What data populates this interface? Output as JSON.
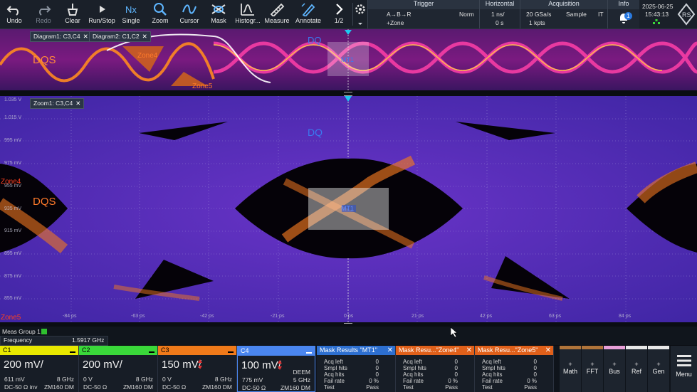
{
  "toolbar": {
    "buttons": [
      {
        "label": "Undo",
        "icon": "undo-icon"
      },
      {
        "label": "Redo",
        "icon": "redo-icon"
      },
      {
        "label": "Clear",
        "icon": "clear-icon"
      },
      {
        "label": "Run/Stop",
        "icon": "run-stop-icon"
      },
      {
        "label": "Single",
        "icon": "single-icon"
      },
      {
        "label": "Zoom",
        "icon": "zoom-icon"
      },
      {
        "label": "Cursor",
        "icon": "cursor-icon"
      },
      {
        "label": "Mask",
        "icon": "mask-icon"
      },
      {
        "label": "Histogr...",
        "icon": "histogram-icon"
      },
      {
        "label": "Measure",
        "icon": "measure-icon"
      },
      {
        "label": "Annotate",
        "icon": "annotate-icon"
      },
      {
        "label": "1/2",
        "icon": "next-page-icon"
      }
    ],
    "trigger": {
      "header": "Trigger",
      "line1": "A→B→R",
      "line2": "+Zone",
      "mode": "Norm"
    },
    "horizontal": {
      "header": "Horizontal",
      "timebase": "1 ns/",
      "position": "0 s"
    },
    "acquisition": {
      "header": "Acquisition",
      "rate": "20 GSa/s",
      "mode": "Sample",
      "points": "1 kpts",
      "it": "IT"
    },
    "info": {
      "header": "Info",
      "badge": "1"
    },
    "date": "2025-06-25",
    "time": "15:43:13"
  },
  "diagram1": {
    "tab1": "Diagram1: C3,C4",
    "tab2": "Diagram2: C1,C2",
    "labels": {
      "dqs": "DQS",
      "dq": "DQ",
      "zone4": "Zone4",
      "zone5": "Zone5",
      "mt1": "MT1"
    }
  },
  "zoom1": {
    "tab": "Zoom1: C3,C4",
    "labels": {
      "dqs": "DQS",
      "dq": "DQ",
      "zone4": "Zone4",
      "zone5": "Zone5",
      "mt1": "MT1"
    },
    "xticks": [
      "-84 ps",
      "-63 ps",
      "-42 ps",
      "-21 ps",
      "0 ps",
      "21 ps",
      "42 ps",
      "63 ps",
      "84 ps"
    ],
    "yticks": [
      "1.035 V",
      "1.015 V",
      "995 mV",
      "975 mV",
      "955 mV",
      "935 mV",
      "915 mV",
      "895 mV",
      "875 mV",
      "855 mV"
    ]
  },
  "meas": {
    "group": "Meas Group 1",
    "name": "Frequency",
    "value": "1.5917 GHz"
  },
  "channels": [
    {
      "name": "C1",
      "color": "#e8e800",
      "scale": "200 mV/",
      "offset": "611 mV",
      "bw": "8 GHz",
      "coupling": "DC-50 Ω inv",
      "probe": "ZM160 DM"
    },
    {
      "name": "C2",
      "color": "#3ad83a",
      "scale": "200 mV/",
      "offset": "0 V",
      "bw": "8 GHz",
      "coupling": "DC-50 Ω",
      "probe": "ZM160 DM"
    },
    {
      "name": "C3",
      "color": "#f07a1a",
      "scale": "150 mV/",
      "offset": "0 V",
      "bw": "8 GHz",
      "coupling": "DC-50 Ω",
      "probe": "ZM160 DM"
    },
    {
      "name": "C4",
      "color": "#4a86f0",
      "scale": "100 mV/",
      "offset": "775 mV",
      "bw": "5 GHz",
      "coupling": "DC-50 Ω",
      "probe": "ZM160 DM",
      "extra": "DEEM"
    }
  ],
  "masks": [
    {
      "title": "Mask Results \"MT1\"",
      "color": "#2d6fd0",
      "rows": [
        [
          "Acq left",
          "0"
        ],
        [
          "Smpl hits",
          "0"
        ],
        [
          "Acq hits",
          "0"
        ],
        [
          "Fail rate",
          "0 %"
        ],
        [
          "Test",
          "Pass"
        ]
      ]
    },
    {
      "title": "Mask Resu...\"Zone4\"",
      "color": "#e0601a",
      "rows": [
        [
          "Acq left",
          "0"
        ],
        [
          "Smpl hits",
          "0"
        ],
        [
          "Acq hits",
          "0"
        ],
        [
          "Fail rate",
          "0 %"
        ],
        [
          "Test",
          "Pass"
        ]
      ]
    },
    {
      "title": "Mask Resu...\"Zone5\"",
      "color": "#e0601a",
      "rows": [
        [
          "Acq left",
          "0"
        ],
        [
          "Smpl hits",
          "0"
        ],
        [
          "Acq hits",
          "0"
        ],
        [
          "Fail rate",
          "0 %"
        ],
        [
          "Test",
          "Pass"
        ]
      ]
    }
  ],
  "side_buttons": [
    {
      "label": "Math",
      "bar": "#b0743a"
    },
    {
      "label": "FFT",
      "bar": "#b0743a"
    },
    {
      "label": "Bus",
      "bar": "#e8a0d8"
    },
    {
      "label": "Ref",
      "bar": "#e8e8e8"
    },
    {
      "label": "Gen",
      "bar": "#e8e8e8"
    }
  ],
  "menu": "Menu"
}
